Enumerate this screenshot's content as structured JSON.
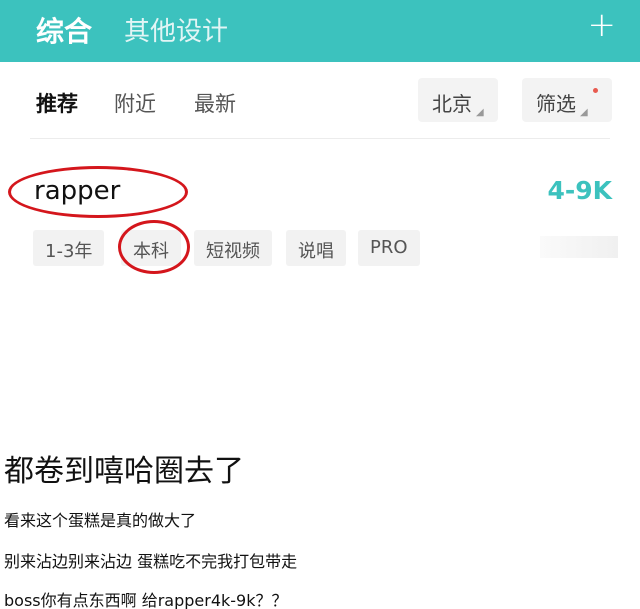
{
  "header": {
    "tab_main": "综合",
    "tab_other": "其他设计",
    "add_icon": "+"
  },
  "filters": {
    "tabs": [
      "推荐",
      "附近",
      "最新"
    ],
    "city": "北京",
    "filter": "筛选"
  },
  "job": {
    "title": "rapper",
    "salary": "4-9K",
    "tags": [
      "1-3年",
      "本科",
      "短视频",
      "说唱",
      "PRO"
    ]
  },
  "caption": {
    "headline": "都卷到嘻哈圈去了",
    "lines": [
      "看来这个蛋糕是真的做大了",
      "别来沾边别来沾边 蛋糕吃不完我打包带走",
      "boss你有点东西啊 给rapper4k-9k？？"
    ]
  },
  "colors": {
    "brand": "#3cc2be",
    "annotation": "#d4161c"
  }
}
